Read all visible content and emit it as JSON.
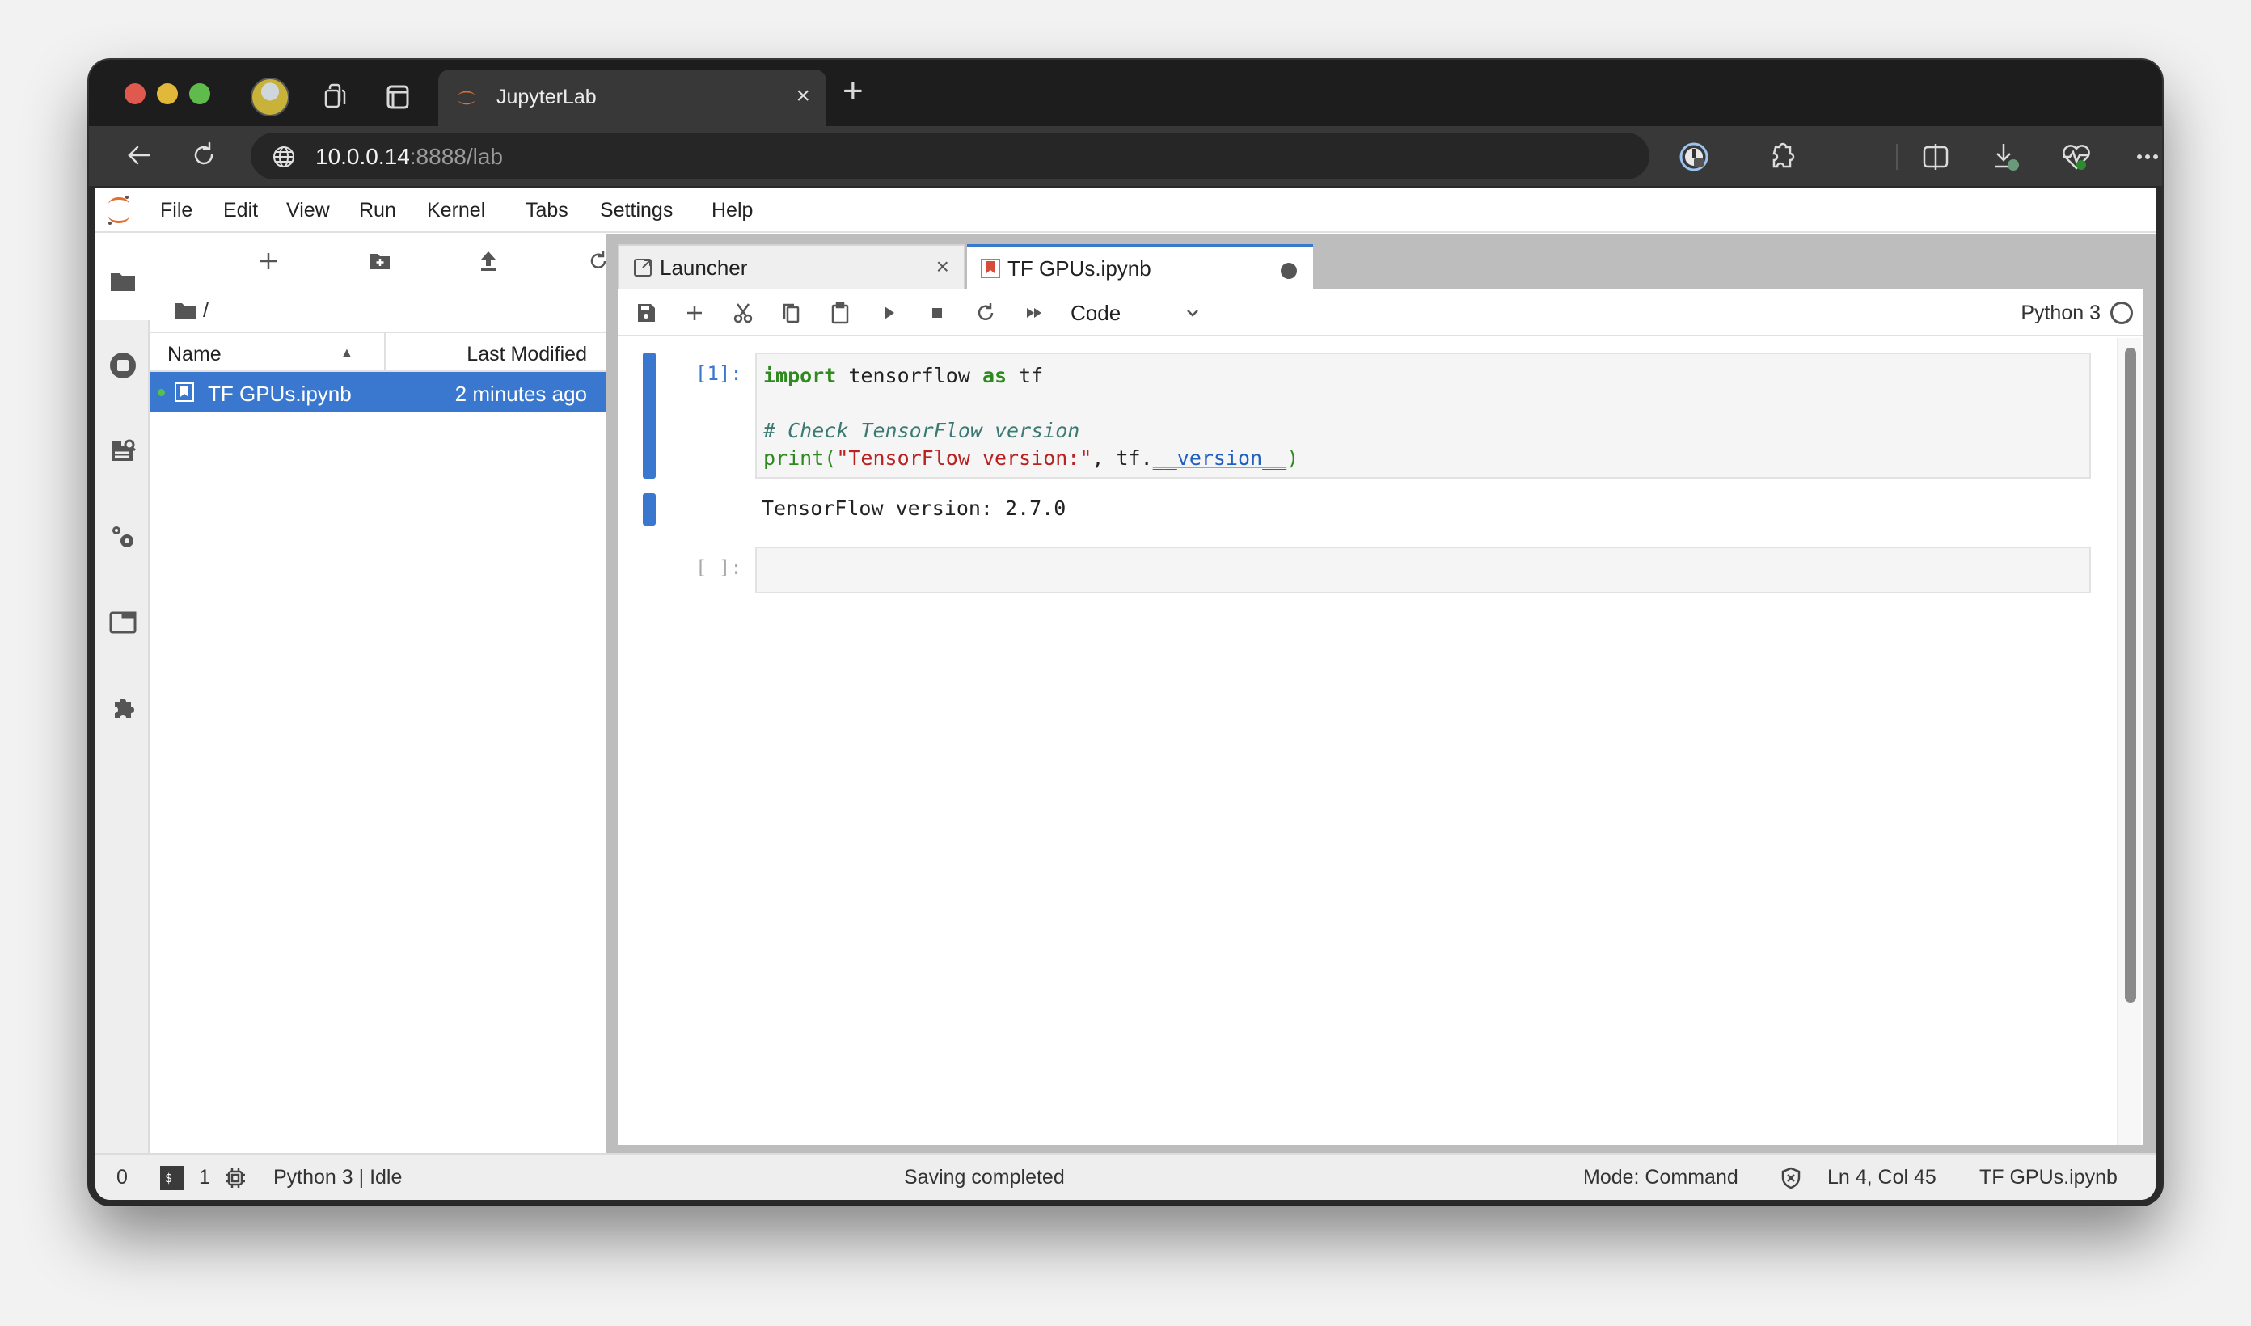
{
  "browser": {
    "tab_title": "JupyterLab",
    "url_host": "10.0.0.14",
    "url_rest": ":8888/lab",
    "icons": {
      "profile": "profile-avatar",
      "workspaces": "workspaces-icon",
      "vertical_tabs": "vertical-tabs-icon",
      "tab_close": "close-icon",
      "new_tab": "plus-icon",
      "back": "arrow-left-icon",
      "reload": "reload-icon",
      "site_info": "globe-icon",
      "password": "password-manager-icon",
      "extensions": "puzzle-icon",
      "split_screen": "split-screen-icon",
      "downloads": "download-icon",
      "performance": "heartbeat-icon",
      "more": "ellipsis-icon",
      "copilot": "copilot-icon"
    },
    "tab_close_glyph": "×",
    "new_tab_glyph": "+",
    "colors": {
      "traffic_red": "#e0594f",
      "traffic_yellow": "#e2b83b",
      "traffic_green": "#5fbb4b"
    }
  },
  "jupyter": {
    "menu": [
      "File",
      "Edit",
      "View",
      "Run",
      "Kernel",
      "Tabs",
      "Settings",
      "Help"
    ],
    "left_sidebar": [
      {
        "name": "file-browser",
        "icon": "folder-icon",
        "active": true
      },
      {
        "name": "running-terminals-kernels",
        "icon": "stop-circle-icon",
        "active": false
      },
      {
        "name": "table-of-contents",
        "icon": "toc-icon",
        "active": false
      },
      {
        "name": "property-inspector",
        "icon": "gears-icon",
        "active": false
      },
      {
        "name": "tabs",
        "icon": "tab-window-icon",
        "active": false
      },
      {
        "name": "extension-manager",
        "icon": "puzzle-icon",
        "active": false
      }
    ],
    "file_browser": {
      "toolbar": [
        "new-launcher",
        "new-folder",
        "upload",
        "refresh"
      ],
      "breadcrumb": "/",
      "columns": {
        "name": "Name",
        "last_modified": "Last Modified"
      },
      "sort_indicator": "▲",
      "files": [
        {
          "name": "TF GPUs.ipynb",
          "modified": "2 minutes ago",
          "selected": true,
          "running": true
        }
      ]
    },
    "dock_tabs": [
      {
        "label": "Launcher",
        "active": false,
        "close": "×"
      },
      {
        "label": "TF GPUs.ipynb",
        "active": true,
        "dirty": true
      }
    ],
    "notebook": {
      "toolbar": [
        "save",
        "insert-cell",
        "cut",
        "copy",
        "paste",
        "run",
        "interrupt",
        "restart",
        "restart-run-all"
      ],
      "cell_type": "Code",
      "kernel_name": "Python 3",
      "cells": [
        {
          "prompt": "[1]:",
          "code": {
            "line1_kw": "import",
            "line1_mid": " tensorflow ",
            "line1_kw2": "as",
            "line1_end": " tf",
            "line3_comment": "# Check TensorFlow version",
            "line4_builtin": "print",
            "line4_open": "(",
            "line4_string": "\"TensorFlow version:\"",
            "line4_mid": ", tf.",
            "line4_attr": "__version__",
            "line4_close": ")"
          },
          "output": "TensorFlow version: 2.7.0"
        },
        {
          "prompt": "[ ]:",
          "code": ""
        }
      ]
    },
    "status_bar": {
      "kernels_count": "0",
      "terminals_count": "1",
      "kernel_status": "Python 3 | Idle",
      "message": "Saving completed",
      "mode": "Mode: Command",
      "cursor": "Ln 4, Col 45",
      "filename": "TF GPUs.ipynb",
      "terminal_badge": "$_"
    },
    "colors": {
      "accent": "#3a78d0",
      "keyword": "#2e8a1e",
      "string": "#ba2121",
      "comment": "#3a7a72",
      "attribute": "#1f5fc2"
    }
  }
}
